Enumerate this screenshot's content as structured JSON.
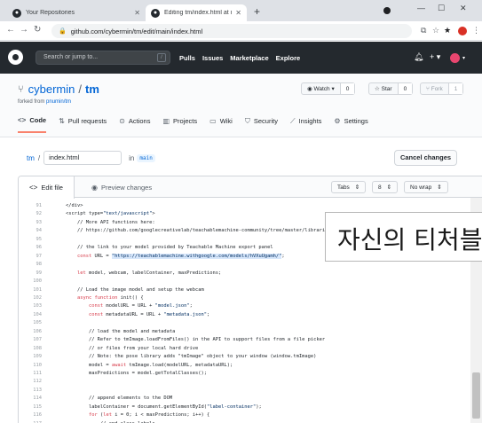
{
  "browser": {
    "tabs": [
      {
        "title": "Your Repositories",
        "active": false
      },
      {
        "title": "Editing tm/index.html at main",
        "active": true
      }
    ],
    "url": "github.com/cybermin/tm/edit/main/index.html"
  },
  "github_header": {
    "search_placeholder": "Search or jump to...",
    "search_shortcut": "/",
    "nav": [
      "Pulls",
      "Issues",
      "Marketplace",
      "Explore"
    ]
  },
  "repo": {
    "owner": "cybermin",
    "name": "tm",
    "forked_prefix": "forked from",
    "forked_from": "pnumin/tm",
    "watch_label": "Watch",
    "watch_count": "0",
    "star_label": "Star",
    "star_count": "0",
    "fork_label": "Fork",
    "fork_count": "1",
    "tabs": [
      {
        "label": "Code",
        "icon": "code-icon",
        "selected": true
      },
      {
        "label": "Pull requests",
        "icon": "pull-request-icon"
      },
      {
        "label": "Actions",
        "icon": "play-icon"
      },
      {
        "label": "Projects",
        "icon": "project-icon"
      },
      {
        "label": "Wiki",
        "icon": "book-icon"
      },
      {
        "label": "Security",
        "icon": "shield-icon"
      },
      {
        "label": "Insights",
        "icon": "graph-icon"
      },
      {
        "label": "Settings",
        "icon": "gear-icon"
      }
    ]
  },
  "edit": {
    "repo_link": "tm",
    "path_sep": "/",
    "filename": "index.html",
    "in_label": "in",
    "branch": "main",
    "cancel_label": "Cancel changes",
    "edit_tab": "Edit file",
    "preview_tab": "Preview changes",
    "indent_mode": "Tabs",
    "indent_size": "8",
    "wrap_mode": "No wrap"
  },
  "code_lines": [
    {
      "n": "91",
      "text": "    </div>"
    },
    {
      "n": "92",
      "text": "    <script type=\"text/javascript\">"
    },
    {
      "n": "93",
      "text": "        // More API functions here:"
    },
    {
      "n": "94",
      "text": "        // https://github.com/googlecreativelab/teachablemachine-community/tree/master/libraries/image"
    },
    {
      "n": "95",
      "text": ""
    },
    {
      "n": "96",
      "text": "        // the link to your model provided by Teachable Machine export panel"
    },
    {
      "n": "97",
      "text": "        const URL = \"https://teachablemachine.withgoogle.com/models/hVXuUgamh/\";"
    },
    {
      "n": "98",
      "text": ""
    },
    {
      "n": "99",
      "text": "        let model, webcam, labelContainer, maxPredictions;"
    },
    {
      "n": "100",
      "text": ""
    },
    {
      "n": "101",
      "text": "        // Load the image model and setup the webcam"
    },
    {
      "n": "102",
      "text": "        async function init() {"
    },
    {
      "n": "103",
      "text": "            const modelURL = URL + \"model.json\";"
    },
    {
      "n": "104",
      "text": "            const metadataURL = URL + \"metadata.json\";"
    },
    {
      "n": "105",
      "text": ""
    },
    {
      "n": "106",
      "text": "            // load the model and metadata"
    },
    {
      "n": "107",
      "text": "            // Refer to tmImage.loadFromFiles() in the API to support files from a file picker"
    },
    {
      "n": "108",
      "text": "            // or files from your local hard drive"
    },
    {
      "n": "109",
      "text": "            // Note: the pose library adds \"tmImage\" object to your window (window.tmImage)"
    },
    {
      "n": "110",
      "text": "            model = await tmImage.load(modelURL, metadataURL);"
    },
    {
      "n": "111",
      "text": "            maxPredictions = model.getTotalClasses();"
    },
    {
      "n": "112",
      "text": ""
    },
    {
      "n": "113",
      "text": ""
    },
    {
      "n": "114",
      "text": "            // append elements to the DOM"
    },
    {
      "n": "115",
      "text": "            labelContainer = document.getElementById(\"label-container\");"
    },
    {
      "n": "116",
      "text": "            for (let i = 0; i < maxPredictions; i++) {"
    },
    {
      "n": "117",
      "text": "                // and class labels"
    }
  ],
  "overlay_caption": "자신의 티처블"
}
